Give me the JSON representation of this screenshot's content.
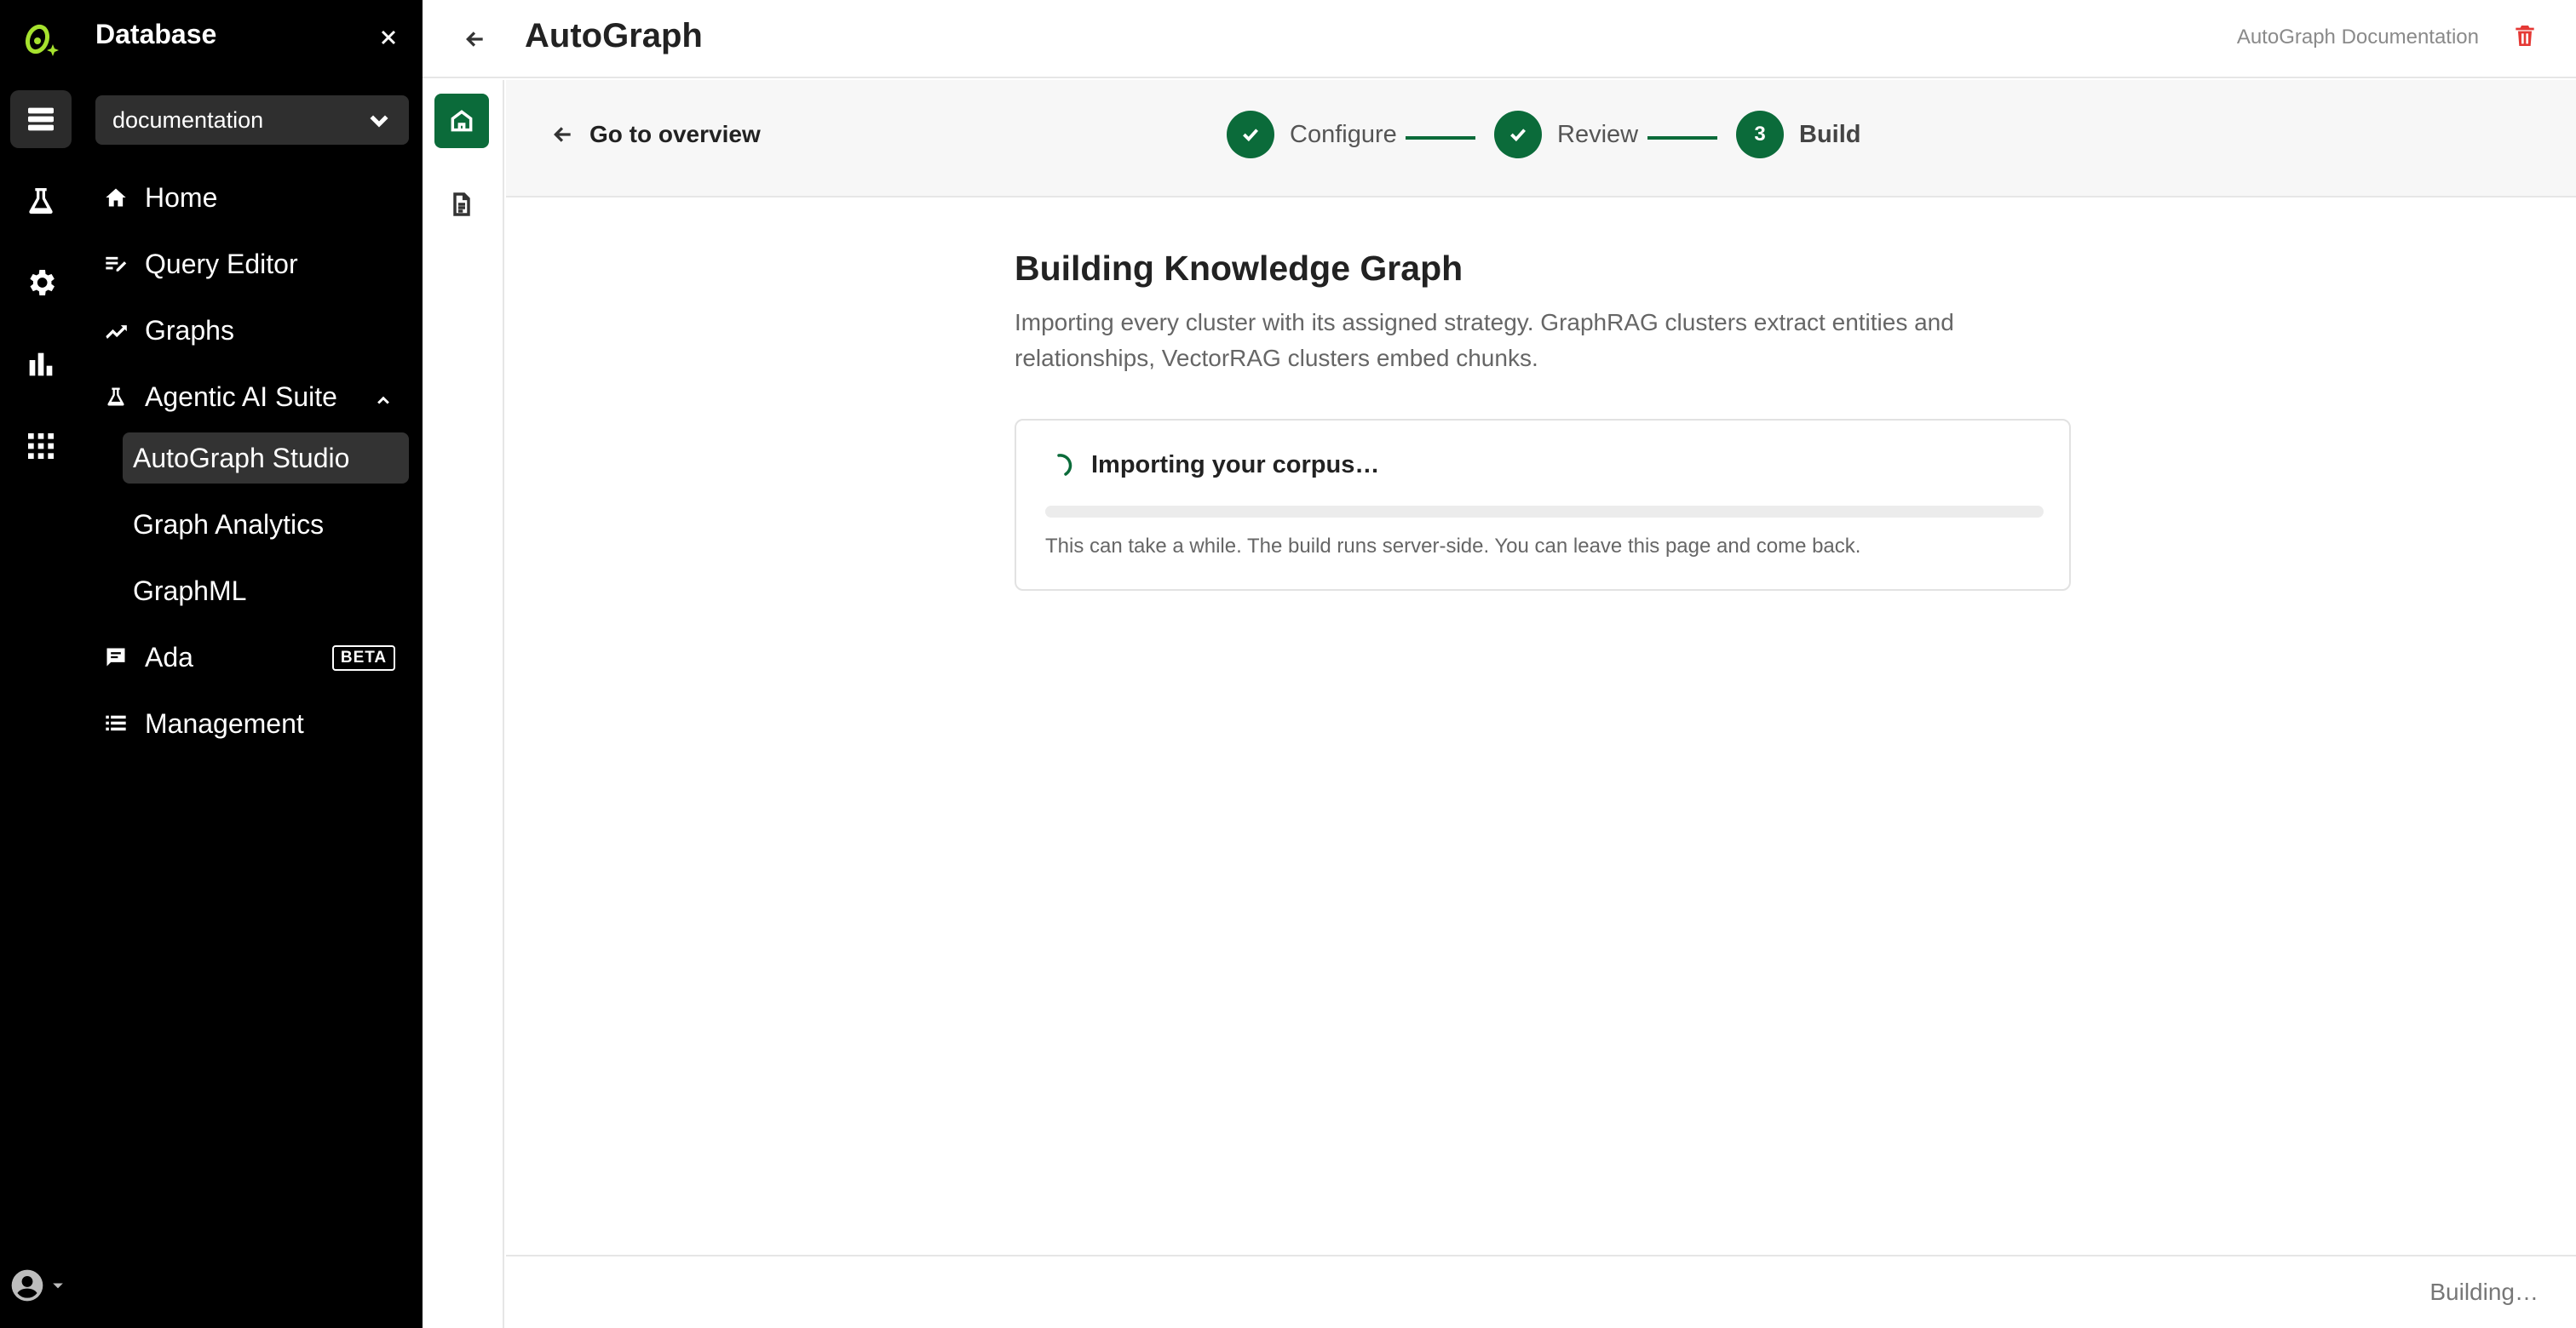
{
  "sidebar": {
    "title": "Database",
    "database": "documentation",
    "items": [
      {
        "label": "Home"
      },
      {
        "label": "Query Editor"
      },
      {
        "label": "Graphs"
      },
      {
        "label": "Agentic AI Suite"
      },
      {
        "label": "Ada",
        "badge": "BETA"
      },
      {
        "label": "Management"
      }
    ],
    "subitems": [
      {
        "label": "AutoGraph Studio",
        "active": true
      },
      {
        "label": "Graph Analytics"
      },
      {
        "label": "GraphML"
      }
    ]
  },
  "header": {
    "title": "AutoGraph",
    "doc_link": "AutoGraph Documentation"
  },
  "stepper": {
    "back_label": "Go to overview",
    "steps": [
      {
        "label": "Configure",
        "status": "complete"
      },
      {
        "label": "Review",
        "status": "complete"
      },
      {
        "label": "Build",
        "number": "3",
        "status": "current"
      }
    ]
  },
  "main": {
    "heading": "Building Knowledge Graph",
    "description": "Importing every cluster with its assigned strategy. GraphRAG clusters extract entities and relationships, VectorRAG clusters embed chunks.",
    "progress": {
      "title": "Importing your corpus…",
      "note": "This can take a while. The build runs server-side. You can leave this page and come back.",
      "fraction": 0
    }
  },
  "footer": {
    "status": "Building…"
  },
  "colors": {
    "accent": "#0b6b3a",
    "sidebar_bg": "#000000",
    "danger": "#e53935"
  }
}
